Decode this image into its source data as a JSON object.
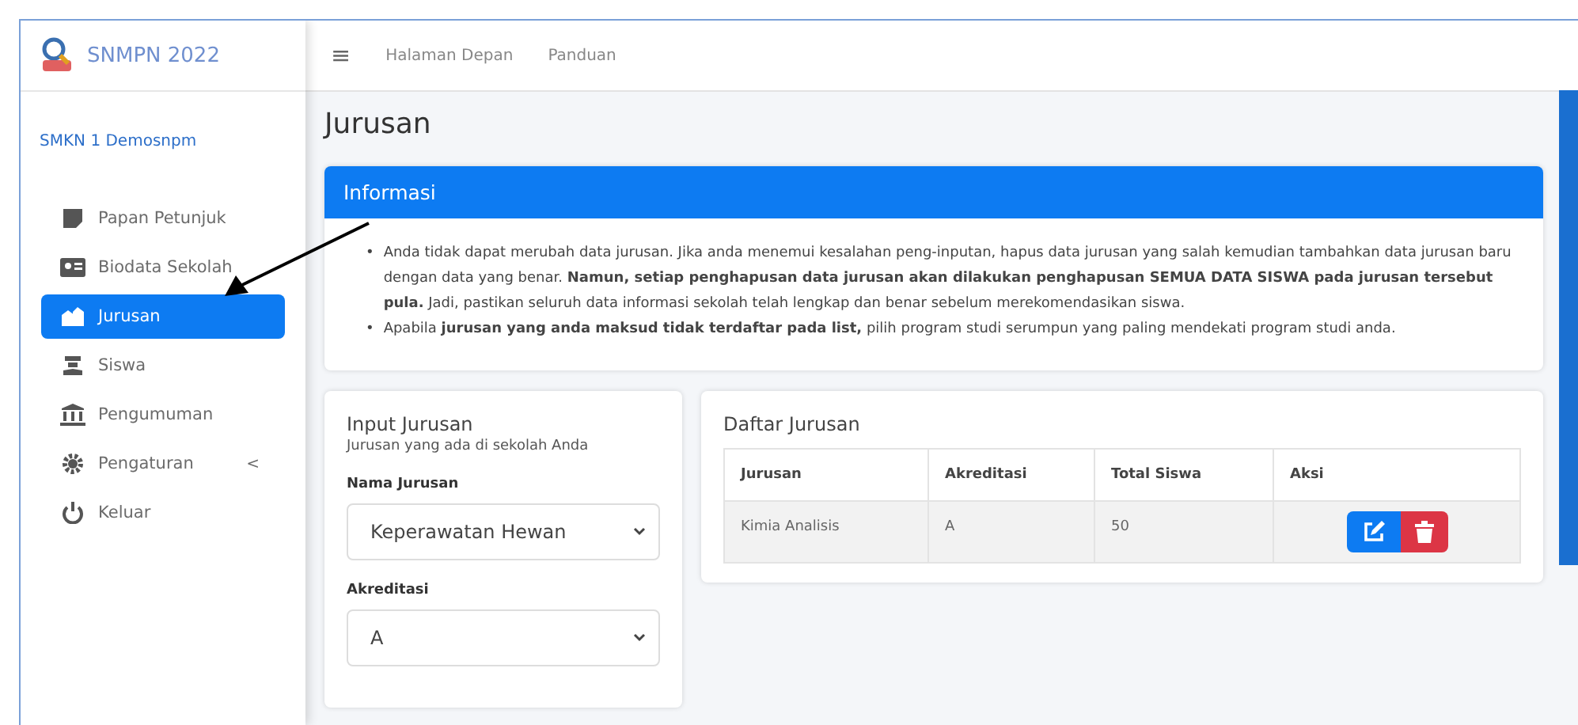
{
  "brand": {
    "title": "SNMPN 2022"
  },
  "school": "SMKN 1 Demosnpm",
  "sidebar": {
    "items": [
      {
        "label": "Papan Petunjuk",
        "selected": false
      },
      {
        "label": "Biodata Sekolah",
        "selected": false
      },
      {
        "label": "Jurusan",
        "selected": true
      },
      {
        "label": "Siswa",
        "selected": false
      },
      {
        "label": "Pengumuman",
        "selected": false
      },
      {
        "label": "Pengaturan",
        "selected": false,
        "caret": "<"
      },
      {
        "label": "Keluar",
        "selected": false
      }
    ]
  },
  "topbar": {
    "menu_icon": "≡",
    "links": [
      "Halaman Depan",
      "Panduan"
    ]
  },
  "page_title": "Jurusan",
  "info": {
    "title": "Informasi",
    "marker": "•",
    "bullets": [
      "Anda tidak dapat merubah data jurusan. Jika anda menemui kesalahan peng-inputan, hapus data jurusan yang salah kemudian tambahkan data jurusan baru dengan data yang benar. **Namun, setiap penghapusan data jurusan akan dilakukan penghapusan SEMUA DATA SISWA pada jurusan tersebut pula.** Jadi, pastikan seluruh data informasi sekolah telah lengkap dan benar sebelum merekomendasikan siswa.",
      "Apabila **jurusan yang anda maksud tidak terdaftar pada list,** pilih program studi serumpun yang paling mendekati program studi anda."
    ]
  },
  "form": {
    "title": "Input Jurusan",
    "subtitle": "Jurusan yang ada di sekolah Anda",
    "fields": [
      {
        "label": "Nama Jurusan",
        "value": "Keperawatan Hewan"
      },
      {
        "label": "Akreditasi",
        "value": "A"
      }
    ]
  },
  "table": {
    "title": "Daftar Jurusan",
    "columns": [
      "Jurusan",
      "Akreditasi",
      "Total Siswa",
      "Aksi"
    ],
    "rows": [
      {
        "cells": [
          "Kimia Analisis",
          "A",
          "50"
        ]
      }
    ]
  }
}
